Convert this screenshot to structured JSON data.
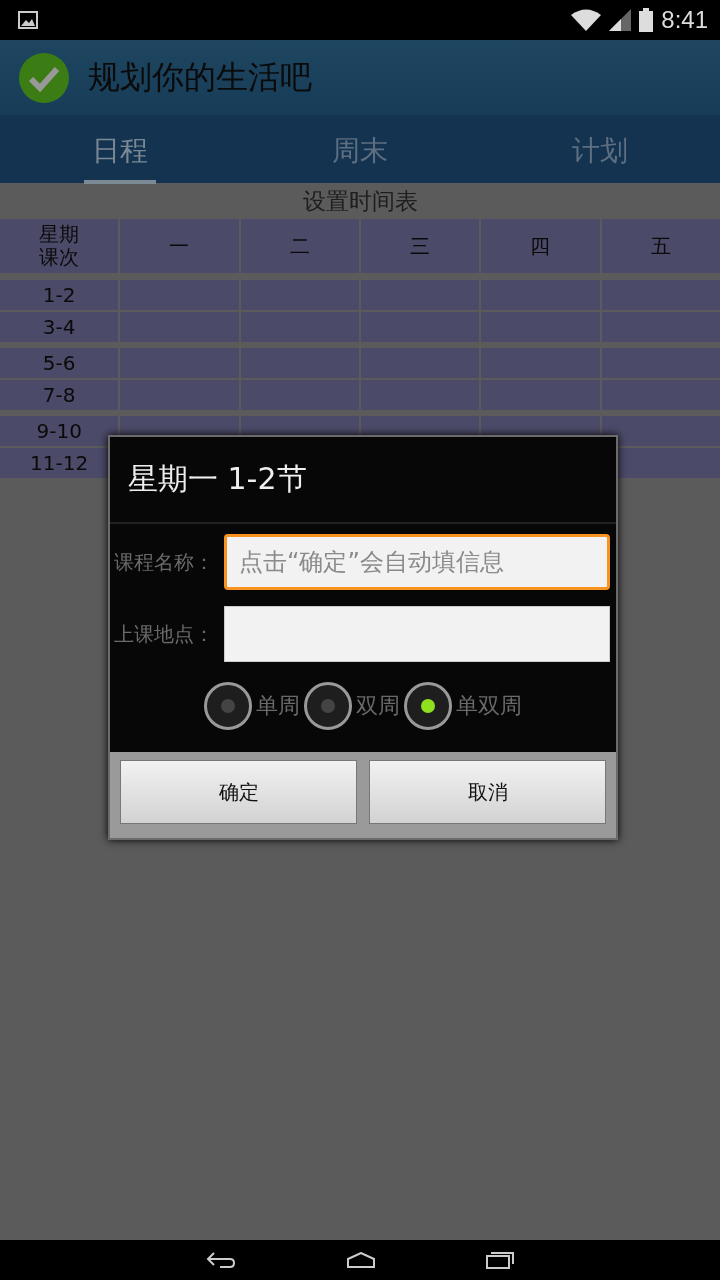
{
  "status_bar": {
    "time": "8:41"
  },
  "action_bar": {
    "title": "规划你的生活吧"
  },
  "tabs": [
    {
      "label": "日程",
      "selected": true
    },
    {
      "label": "周末",
      "selected": false
    },
    {
      "label": "计划",
      "selected": false
    }
  ],
  "timetable": {
    "title": "设置时间表",
    "corner": [
      "星期",
      "课次"
    ],
    "columns": [
      "一",
      "二",
      "三",
      "四",
      "五"
    ],
    "groups": [
      {
        "rows": [
          "1-2",
          "3-4"
        ]
      },
      {
        "rows": [
          "5-6",
          "7-8"
        ]
      },
      {
        "rows": [
          "9-10",
          "11-12"
        ]
      }
    ]
  },
  "dialog": {
    "title": "星期一  1-2节",
    "fields": [
      {
        "label": "课程名称：",
        "placeholder": "点击“确定”会自动填信息",
        "focused": true
      },
      {
        "label": "上课地点：",
        "focused": false
      }
    ],
    "options": [
      {
        "label": "单周",
        "selected": false
      },
      {
        "label": "双周",
        "selected": false
      },
      {
        "label": "单双周",
        "selected": true
      }
    ],
    "buttons": [
      "确定",
      "取消"
    ]
  }
}
